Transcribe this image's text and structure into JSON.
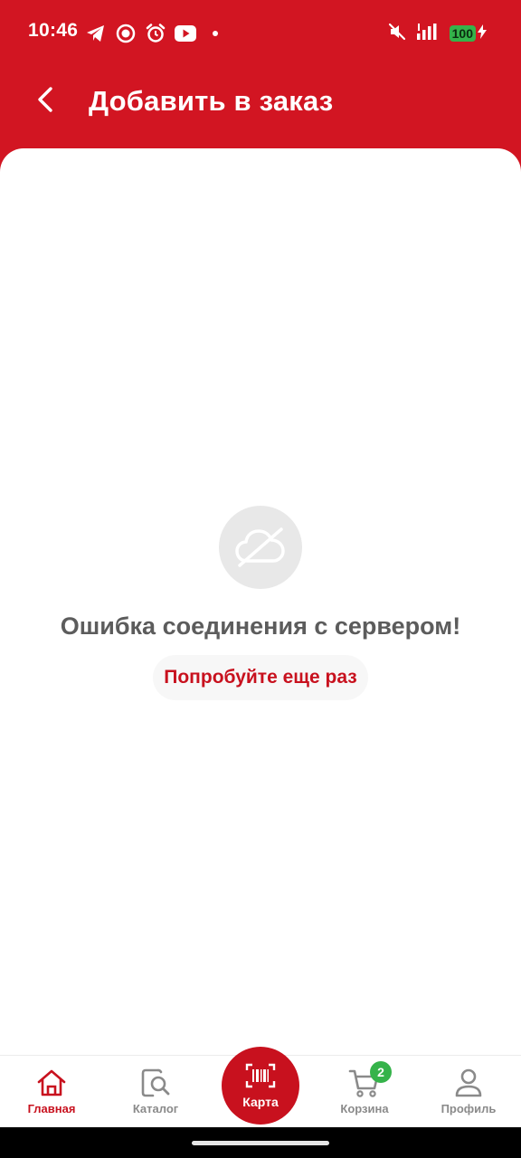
{
  "status_bar": {
    "time": "10:46",
    "battery_level": "100",
    "icons": [
      "telegram-icon",
      "record-icon",
      "alarm-icon",
      "youtube-icon",
      "dot-icon",
      "mute-icon",
      "signal-icon",
      "battery-icon",
      "charging-icon"
    ]
  },
  "header": {
    "title": "Добавить в заказ",
    "back_icon": "chevron-left-icon"
  },
  "error": {
    "icon": "cloud-off-icon",
    "message": "Ошибка соединения с сервером!",
    "retry_label": "Попробуйте еще раз"
  },
  "bottom_nav": {
    "items": [
      {
        "label": "Главная",
        "icon": "home-icon",
        "active": true
      },
      {
        "label": "Каталог",
        "icon": "catalog-search-icon",
        "active": false
      },
      {
        "label": "Карта",
        "icon": "barcode-icon",
        "active": false
      },
      {
        "label": "Корзина",
        "icon": "cart-icon",
        "active": false,
        "badge": "2"
      },
      {
        "label": "Профиль",
        "icon": "profile-icon",
        "active": false
      }
    ]
  },
  "colors": {
    "brand_red": "#d21522",
    "accent_red": "#c8111e",
    "badge_green": "#35b34a",
    "error_text": "#5c5c5c"
  }
}
